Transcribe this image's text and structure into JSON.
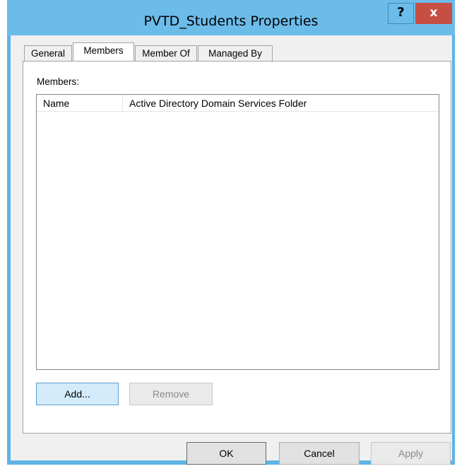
{
  "window": {
    "title": "PVTD_Students Properties",
    "help_label": "?",
    "close_label": "x"
  },
  "tabs": [
    {
      "label": "General",
      "active": false
    },
    {
      "label": "Members",
      "active": true
    },
    {
      "label": "Member Of",
      "active": false
    },
    {
      "label": "Managed By",
      "active": false
    }
  ],
  "members": {
    "label": "Members:",
    "columns": [
      "Name",
      "Active Directory Domain Services Folder"
    ],
    "rows": [],
    "add_label": "Add...",
    "remove_label": "Remove"
  },
  "footer": {
    "ok_label": "OK",
    "cancel_label": "Cancel",
    "apply_label": "Apply"
  },
  "colors": {
    "title_bar": "#6cbcea",
    "close_button": "#c74e43",
    "focused_button": "#d3ebfa"
  }
}
